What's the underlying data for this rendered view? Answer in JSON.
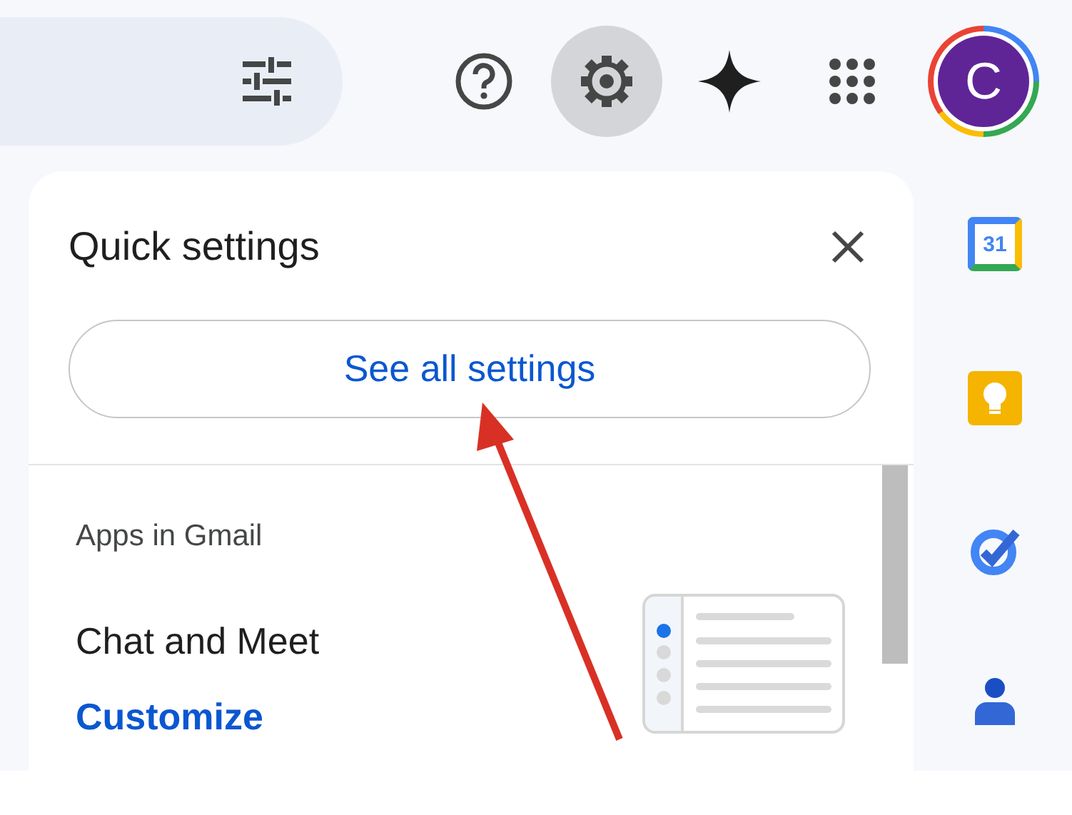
{
  "toolbar": [
    {
      "kind": "help",
      "selected": false
    },
    {
      "kind": "settings",
      "selected": true
    },
    {
      "kind": "sparkle",
      "selected": false
    },
    {
      "kind": "apps",
      "selected": false
    }
  ],
  "account": {
    "initial": "C"
  },
  "quick_settings": {
    "title": "Quick settings",
    "button": "See all settings",
    "section": "Apps in Gmail",
    "setting_label": "Chat and Meet",
    "link": "Customize"
  },
  "side_panel": {
    "calendar_day": "31"
  }
}
